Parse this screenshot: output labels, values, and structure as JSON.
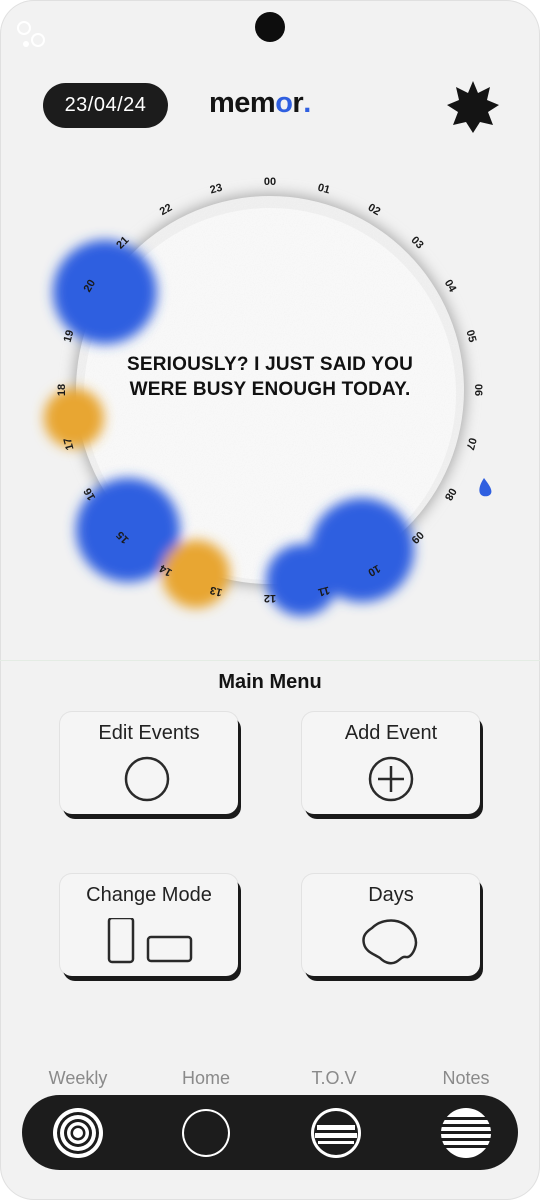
{
  "header": {
    "date": "23/04/24",
    "logo_text": "mem",
    "logo_o": "o",
    "logo_end": "r",
    "logo_dot": ".",
    "settings_icon": "star-icon"
  },
  "dial": {
    "hour_labels": [
      "00",
      "01",
      "02",
      "03",
      "04",
      "05",
      "06",
      "07",
      "08",
      "09",
      "10",
      "11",
      "12",
      "13",
      "14",
      "15",
      "16",
      "17",
      "18",
      "19",
      "20",
      "21",
      "22",
      "23"
    ],
    "message": "SERIOUSLY? I JUST SAID YOU WERE BUSY ENOUGH TODAY.",
    "colors": {
      "blue": "#2f5fe0",
      "orange": "#e8a630"
    }
  },
  "menu": {
    "title": "Main Menu",
    "cards": {
      "edit_events": {
        "label": "Edit Events",
        "icon": "circle-icon"
      },
      "add_event": {
        "label": "Add Event",
        "icon": "plus-circle-icon"
      },
      "change_mode": {
        "label": "Change Mode",
        "icon": "orientation-icon"
      },
      "days": {
        "label": "Days",
        "icon": "blob-icon"
      }
    }
  },
  "tabs": [
    {
      "label": "Weekly",
      "icon": "concentric-circles-icon"
    },
    {
      "label": "Home",
      "icon": "circle-icon"
    },
    {
      "label": "T.O.V",
      "icon": "striped-circle-icon"
    },
    {
      "label": "Notes",
      "icon": "lined-circle-icon"
    }
  ]
}
